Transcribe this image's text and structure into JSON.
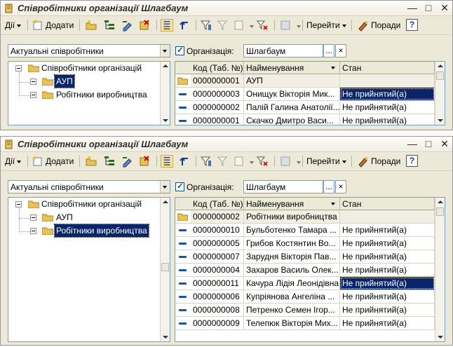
{
  "windows": [
    {
      "title": "Співробітники організації Шлагбаум",
      "toolbar": {
        "actions_label": "Дії",
        "add_label": "Додати",
        "goto_label": "Перейти",
        "tips_label": "Поради",
        "help_label": "?"
      },
      "filter": {
        "state_select": "Актуальні співробітники",
        "org_checked": true,
        "org_label": "Організація:",
        "org_value": "Шлагбаум",
        "choose_btn": "...",
        "clear_btn": "×"
      },
      "tree": {
        "root": "Співробітники організацій",
        "children": [
          {
            "label": "АУП",
            "selected": true
          },
          {
            "label": "Робітники виробництва",
            "selected": false
          }
        ]
      },
      "grid": {
        "columns": [
          "Код (Таб. №)",
          "Найменування",
          "Стан"
        ],
        "rows": [
          {
            "kind": "group",
            "code": "0000000001",
            "name": "АУП",
            "state": ""
          },
          {
            "kind": "item",
            "code": "0000000003",
            "name": "Онищук Вікторія Мик...",
            "state": "Не прийнятий(а)",
            "selected": true
          },
          {
            "kind": "item",
            "code": "0000000002",
            "name": "Палій Галина Анатолії...",
            "state": "Не прийнятий(а)"
          },
          {
            "kind": "item",
            "code": "0000000001",
            "name": "Скачко Дмитро Васи...",
            "state": "Не прийнятий(а)"
          }
        ]
      }
    },
    {
      "title": "Співробітники організації Шлагбаум",
      "toolbar": {
        "actions_label": "Дії",
        "add_label": "Додати",
        "goto_label": "Перейти",
        "tips_label": "Поради",
        "help_label": "?"
      },
      "filter": {
        "state_select": "Актуальні співробітники",
        "org_checked": true,
        "org_label": "Організація:",
        "org_value": "Шлагбаум",
        "choose_btn": "...",
        "clear_btn": "×"
      },
      "tree": {
        "root": "Співробітники організацій",
        "children": [
          {
            "label": "АУП",
            "selected": false
          },
          {
            "label": "Робітники виробництва",
            "selected": true
          }
        ]
      },
      "grid": {
        "columns": [
          "Код (Таб. №)",
          "Найменування",
          "Стан"
        ],
        "rows": [
          {
            "kind": "group",
            "code": "0000000002",
            "name": "Робітники виробництва",
            "state": ""
          },
          {
            "kind": "item",
            "code": "0000000010",
            "name": "Бульботенко Тамара ...",
            "state": "Не прийнятий(а)"
          },
          {
            "kind": "item",
            "code": "0000000005",
            "name": "Грибов Костянтин Во...",
            "state": "Не прийнятий(а)"
          },
          {
            "kind": "item",
            "code": "0000000007",
            "name": "Зарудня Вікторія Пав...",
            "state": "Не прийнятий(а)"
          },
          {
            "kind": "item",
            "code": "0000000004",
            "name": "Захаров Василь Олек...",
            "state": "Не прийнятий(а)"
          },
          {
            "kind": "item",
            "code": "0000000011",
            "name": "Качура Лідія Леонідівна",
            "state": "Не прийнятий(а)",
            "selected": true
          },
          {
            "kind": "item",
            "code": "0000000006",
            "name": "Купріянова Ангеліна ...",
            "state": "Не прийнятий(а)"
          },
          {
            "kind": "item",
            "code": "0000000008",
            "name": "Петренко Семен Ігор...",
            "state": "Не прийнятий(а)"
          },
          {
            "kind": "item",
            "code": "0000000009",
            "name": "Телепюк Вікторія Мих...",
            "state": "Не прийнятий(а)"
          }
        ]
      }
    }
  ],
  "icons": [
    "app-icon",
    "folder-icon",
    "element-icon",
    "minimize-icon",
    "maximize-icon",
    "close-icon"
  ],
  "colors": {
    "selection": "#0a246a",
    "window_bg": "#ece9d8",
    "item_icon": "#1a4fb2",
    "folder": "#e8c15a"
  }
}
